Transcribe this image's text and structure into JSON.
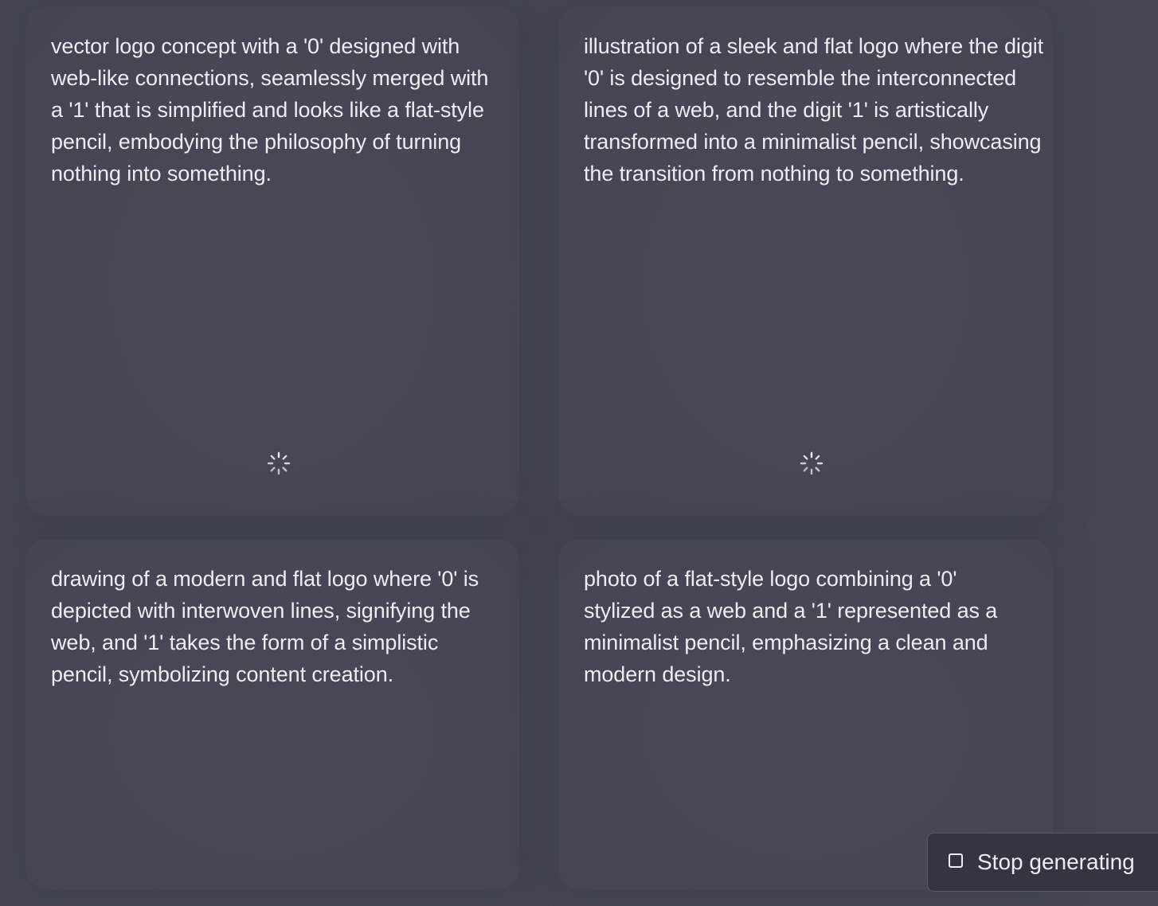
{
  "cards": [
    {
      "prompt": "vector logo concept with a '0' designed with web-like connections, seamlessly merged with a '1' that is simplified and looks like a flat-style pencil, embodying the philosophy of turning nothing into something.",
      "state": "loading",
      "icon": "spinner-icon"
    },
    {
      "prompt": "illustration of a sleek and flat logo where the digit '0' is designed to resemble the interconnected lines of a web, and the digit '1' is artistically transformed into a minimalist pencil, showcasing the transition from nothing to something.",
      "state": "loading",
      "icon": "spinner-icon"
    },
    {
      "prompt": "drawing of a modern and flat logo where '0' is depicted with interwoven lines, signifying the web, and '1' takes the form of a simplistic pencil, symbolizing content creation."
    },
    {
      "prompt": "photo of a flat-style logo combining a '0' stylized as a web and a '1' represented as a minimalist pencil, emphasizing a clean and modern design."
    }
  ],
  "stop_button": {
    "label": "Stop generating",
    "icon": "stop-square-icon"
  },
  "colors": {
    "background": "#444654",
    "text": "#ececf1",
    "button_background": "#343541",
    "button_border": "#565869"
  }
}
